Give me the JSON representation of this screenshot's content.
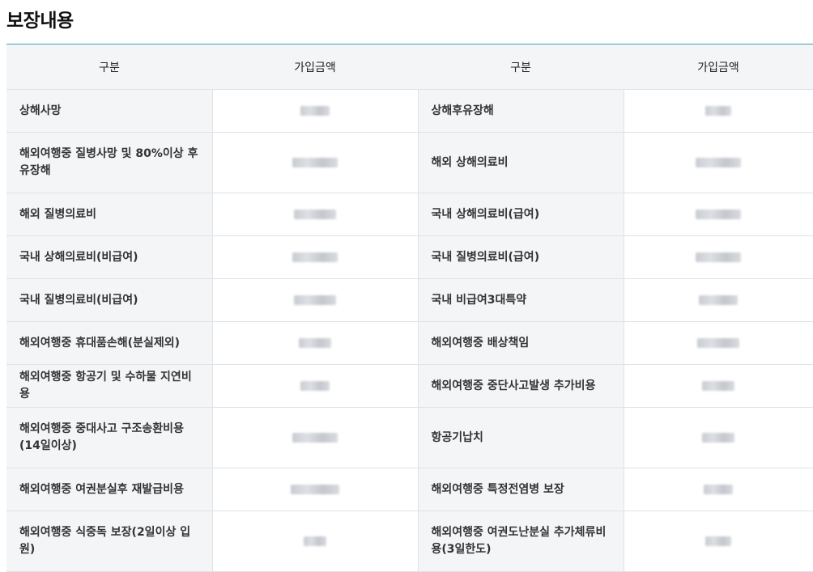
{
  "page": {
    "title": "보장내용"
  },
  "table": {
    "headers": [
      "구분",
      "가입금액",
      "구분",
      "가입금액"
    ],
    "rows": [
      {
        "left": "상해사망",
        "right": "상해후유장해",
        "h": 53
      },
      {
        "left": "해외여행중 질병사망 및 80%이상 후유장해",
        "right": "해외 상해의료비",
        "h": 75
      },
      {
        "left": "해외 질병의료비",
        "right": "국내 상해의료비(급여)",
        "h": 53
      },
      {
        "left": "국내 상해의료비(비급여)",
        "right": "국내 질병의료비(급여)",
        "h": 53
      },
      {
        "left": "국내 질병의료비(비급여)",
        "right": "국내 비급여3대특약",
        "h": 53
      },
      {
        "left": "해외여행중 휴대품손해(분실제외)",
        "right": "해외여행중 배상책임",
        "h": 53
      },
      {
        "left": "해외여행중 항공기 및 수하물 지연비용",
        "right": "해외여행중 중단사고발생 추가비용",
        "h": 53
      },
      {
        "left": "해외여행중 중대사고 구조송환비용(14일이상)",
        "right": "항공기납치",
        "h": 75
      },
      {
        "left": "해외여행중 여권분실후 재발급비용",
        "right": "해외여행중 특정전염병 보장",
        "h": 53
      },
      {
        "left": "해외여행중 식중독 보장(2일이상 입원)",
        "right": "해외여행중 여권도난분실 추가체류비용(3일한도)",
        "h": 75
      }
    ]
  }
}
